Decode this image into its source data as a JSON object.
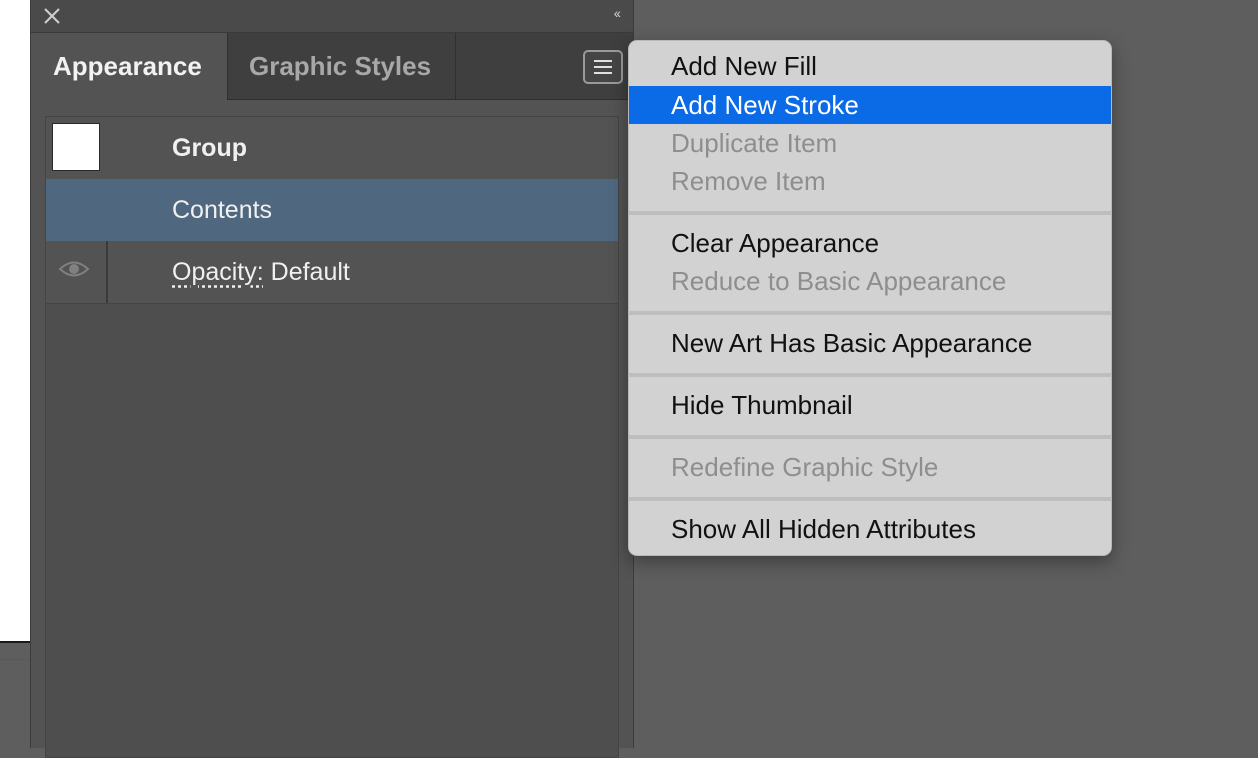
{
  "panel": {
    "tabs": [
      {
        "label": "Appearance",
        "active": true
      },
      {
        "label": "Graphic Styles",
        "active": false
      }
    ],
    "collapse_glyph": "‹‹",
    "rows": {
      "group": {
        "label": "Group"
      },
      "contents": {
        "label": "Contents"
      },
      "opacity": {
        "link_label": "Opacity:",
        "value": " Default"
      }
    }
  },
  "menu": {
    "items": [
      {
        "label": "Add New Fill",
        "enabled": true
      },
      {
        "label": "Add New Stroke",
        "enabled": true,
        "highlighted": true
      },
      {
        "label": "Duplicate Item",
        "enabled": false
      },
      {
        "label": "Remove Item",
        "enabled": false
      },
      {
        "label": "Clear Appearance",
        "enabled": true
      },
      {
        "label": "Reduce to Basic Appearance",
        "enabled": false
      },
      {
        "label": "New Art Has Basic Appearance",
        "enabled": true
      },
      {
        "label": "Hide Thumbnail",
        "enabled": true
      },
      {
        "label": "Redefine Graphic Style",
        "enabled": false
      },
      {
        "label": "Show All Hidden Attributes",
        "enabled": true
      }
    ]
  },
  "colors": {
    "highlight": "#0b6ae6",
    "selected_row": "#4f6880",
    "panel_bg": "#535353"
  },
  "icons": [
    "close-icon",
    "collapse-icon",
    "panel-menu-icon",
    "eye-icon"
  ]
}
